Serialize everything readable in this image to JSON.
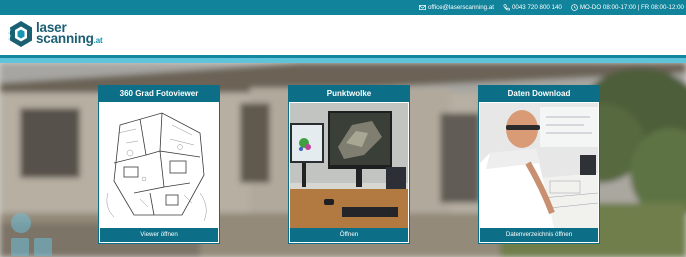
{
  "contact_bar": {
    "email": "office@laserscanning.at",
    "phone": "0043 720 800 140",
    "hours": "MO-DO 08:00-17:00 | FR 08:00-12:00"
  },
  "logo": {
    "line1": "laser",
    "line2": "scanning",
    "tld": ".at"
  },
  "cards": [
    {
      "title": "360 Grad Fotoviewer",
      "button": "Viewer öffnen"
    },
    {
      "title": "Punktwolke",
      "button": "Öffnen"
    },
    {
      "title": "Daten Download",
      "button": "Datenverzeichnis öffnen"
    }
  ],
  "colors": {
    "brand_dark": "#0c6f87",
    "brand_light": "#5fc3d9",
    "topbar": "#11839b"
  }
}
